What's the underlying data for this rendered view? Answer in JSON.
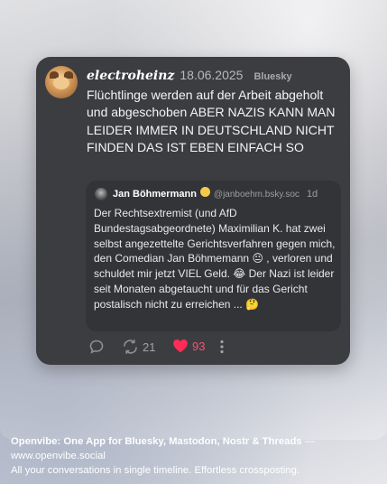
{
  "post": {
    "author": "electroheinz",
    "date": "18.06.2025",
    "network": "Bluesky",
    "text": "Flüchtlinge werden auf der Arbeit abgeholt und abgeschoben ABER NAZIS KANN MAN LEIDER IMMER IN DEUTSCHLAND NICHT FINDEN DAS IST EBEN EINFACH SO"
  },
  "quote": {
    "name": "Jan Böhmermann",
    "handle": "@janboehm.bsky.soc",
    "time": "1d",
    "text": "Der Rechtsextremist (und AfD Bundestagsabgeordnete) Maximilian K. hat zwei selbst angezettelte Gerichtsverfahren gegen mich, den Comedian Jan Böhmemann 😐 , verloren und schuldet mir jetzt VIEL Geld. 😂  Der Nazi ist leider seit Monaten abgetaucht und für das Gericht postalisch nicht zu erreichen ... 🤔"
  },
  "actions": {
    "reposts": "21",
    "likes": "93"
  },
  "icons": {
    "reply": "speech-bubble-icon",
    "repost": "repost-arrows-icon",
    "like": "heart-icon",
    "more": "vertical-ellipsis-icon"
  },
  "colors": {
    "card": "#3c3d41",
    "quote": "#333438",
    "like": "#ff2d55"
  },
  "caption": {
    "title": "Openvibe: One App for Bluesky, Mastodon, Nostr & Threads",
    "dash": " —",
    "url": "www.openvibe.social",
    "tagline": "All your conversations in single timeline. Effortless crossposting."
  }
}
